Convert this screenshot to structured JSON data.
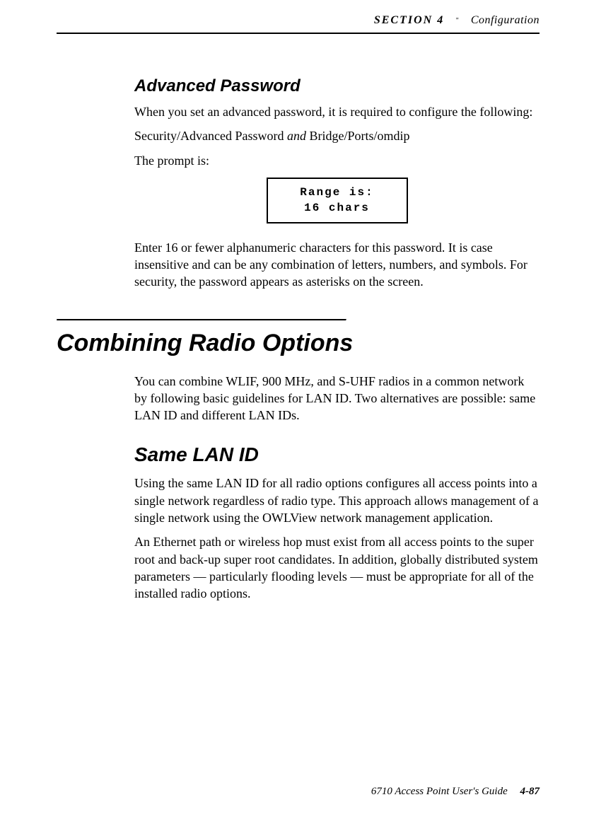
{
  "header": {
    "section": "SECTION 4",
    "separator": "\"",
    "title": "Configuration"
  },
  "advancedPassword": {
    "heading": "Advanced Password",
    "p1": "When you set an advanced password, it is required to configure the following:",
    "p2_pre": "Security/Advanced Password ",
    "p2_italic": "and",
    "p2_post": " Bridge/Ports/omdip",
    "p3": "The prompt is:",
    "prompt_line1": "Range is:",
    "prompt_line2": "16 chars",
    "p4": "Enter 16 or fewer alphanumeric characters for this password.  It is case insensitive and can be any combination of letters, numbers, and symbols.  For security, the password appears as asterisks on the screen."
  },
  "combining": {
    "heading": "Combining Radio Options",
    "p1": "You can combine WLIF, 900 MHz, and S-UHF radios in a common network by following basic guidelines for LAN ID.  Two alternatives are possible:  same LAN ID and different LAN IDs."
  },
  "sameLan": {
    "heading": "Same LAN ID",
    "p1": "Using the same LAN ID for all radio options configures all access points into a single network regardless of radio type.  This approach allows management of a single network using the OWLView network management application.",
    "p2": "An Ethernet path or wireless hop must exist from all access points to the super root and back-up super root candidates.  In addition, globally distributed system parameters — particularly flooding levels — must be appropriate for all of the installed radio options."
  },
  "footer": {
    "guide": "6710 Access Point User's Guide",
    "page": "4-87"
  }
}
